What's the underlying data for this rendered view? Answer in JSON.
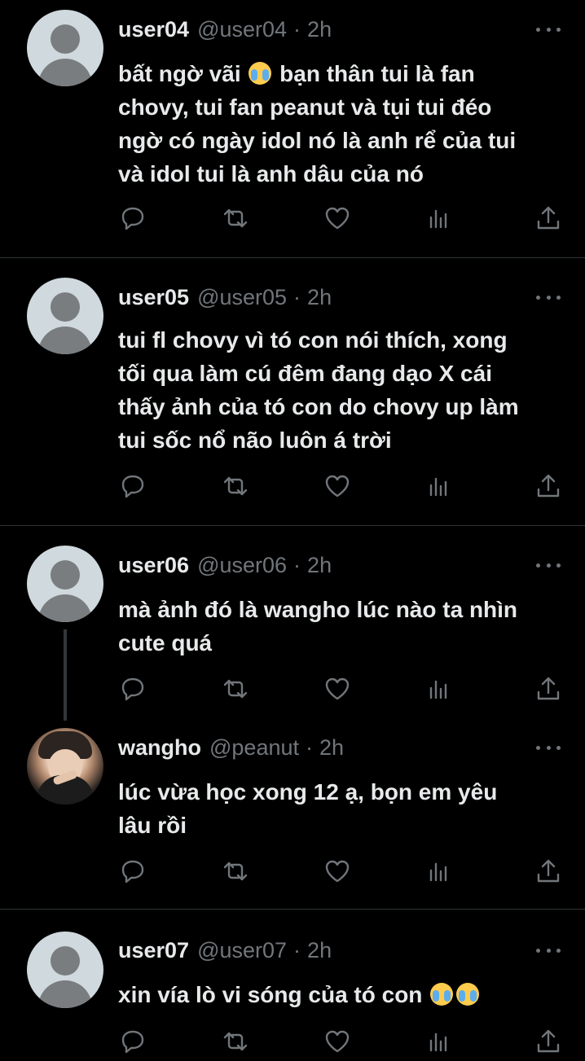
{
  "tweets": [
    {
      "name": "user04",
      "handle": "@user04",
      "time": "2h",
      "dot": "·",
      "lines": [
        "bất ngờ vãi",
        " bạn thân tui là fan",
        "chovy, tui fan peanut và tụi tui đéo",
        "ngờ có ngày idol nó là anh rể của tui",
        "và idol tui là anh dâu của nó"
      ],
      "avatar": "default-avatar"
    },
    {
      "name": "user05",
      "handle": "@user05",
      "time": "2h",
      "dot": "·",
      "lines": [
        "tui fl chovy vì tó con nói thích, xong",
        "tối qua làm cú đêm đang dạo X cái",
        "thấy ảnh của tó con do chovy up làm",
        "tui sốc nổ não luôn á trời"
      ],
      "avatar": "default-avatar"
    },
    {
      "name": "user06",
      "handle": "@user06",
      "time": "2h",
      "dot": "·",
      "lines": [
        "mà ảnh đó là wangho lúc nào ta nhìn",
        "cute quá"
      ],
      "avatar": "default-avatar"
    },
    {
      "name": "wangho",
      "handle": "@peanut",
      "time": "2h",
      "dot": "·",
      "lines": [
        "lúc vừa học xong 12 ạ, bọn em yêu",
        "lâu rồi"
      ],
      "avatar": "photo-avatar"
    },
    {
      "name": "user07",
      "handle": "@user07",
      "time": "2h",
      "dot": "·",
      "lines": [
        "xin vía lò vi sóng của tó con"
      ],
      "avatar": "default-avatar"
    }
  ],
  "icons": {
    "reply": "reply-icon",
    "retweet": "retweet-icon",
    "like": "like-icon",
    "views": "views-icon",
    "share": "share-icon",
    "more": "more-icon",
    "emoji": "loudly-crying-face-emoji"
  },
  "colors": {
    "background": "#000000",
    "text": "#e7e9ea",
    "muted": "#71767b",
    "separator": "#2f3336"
  }
}
